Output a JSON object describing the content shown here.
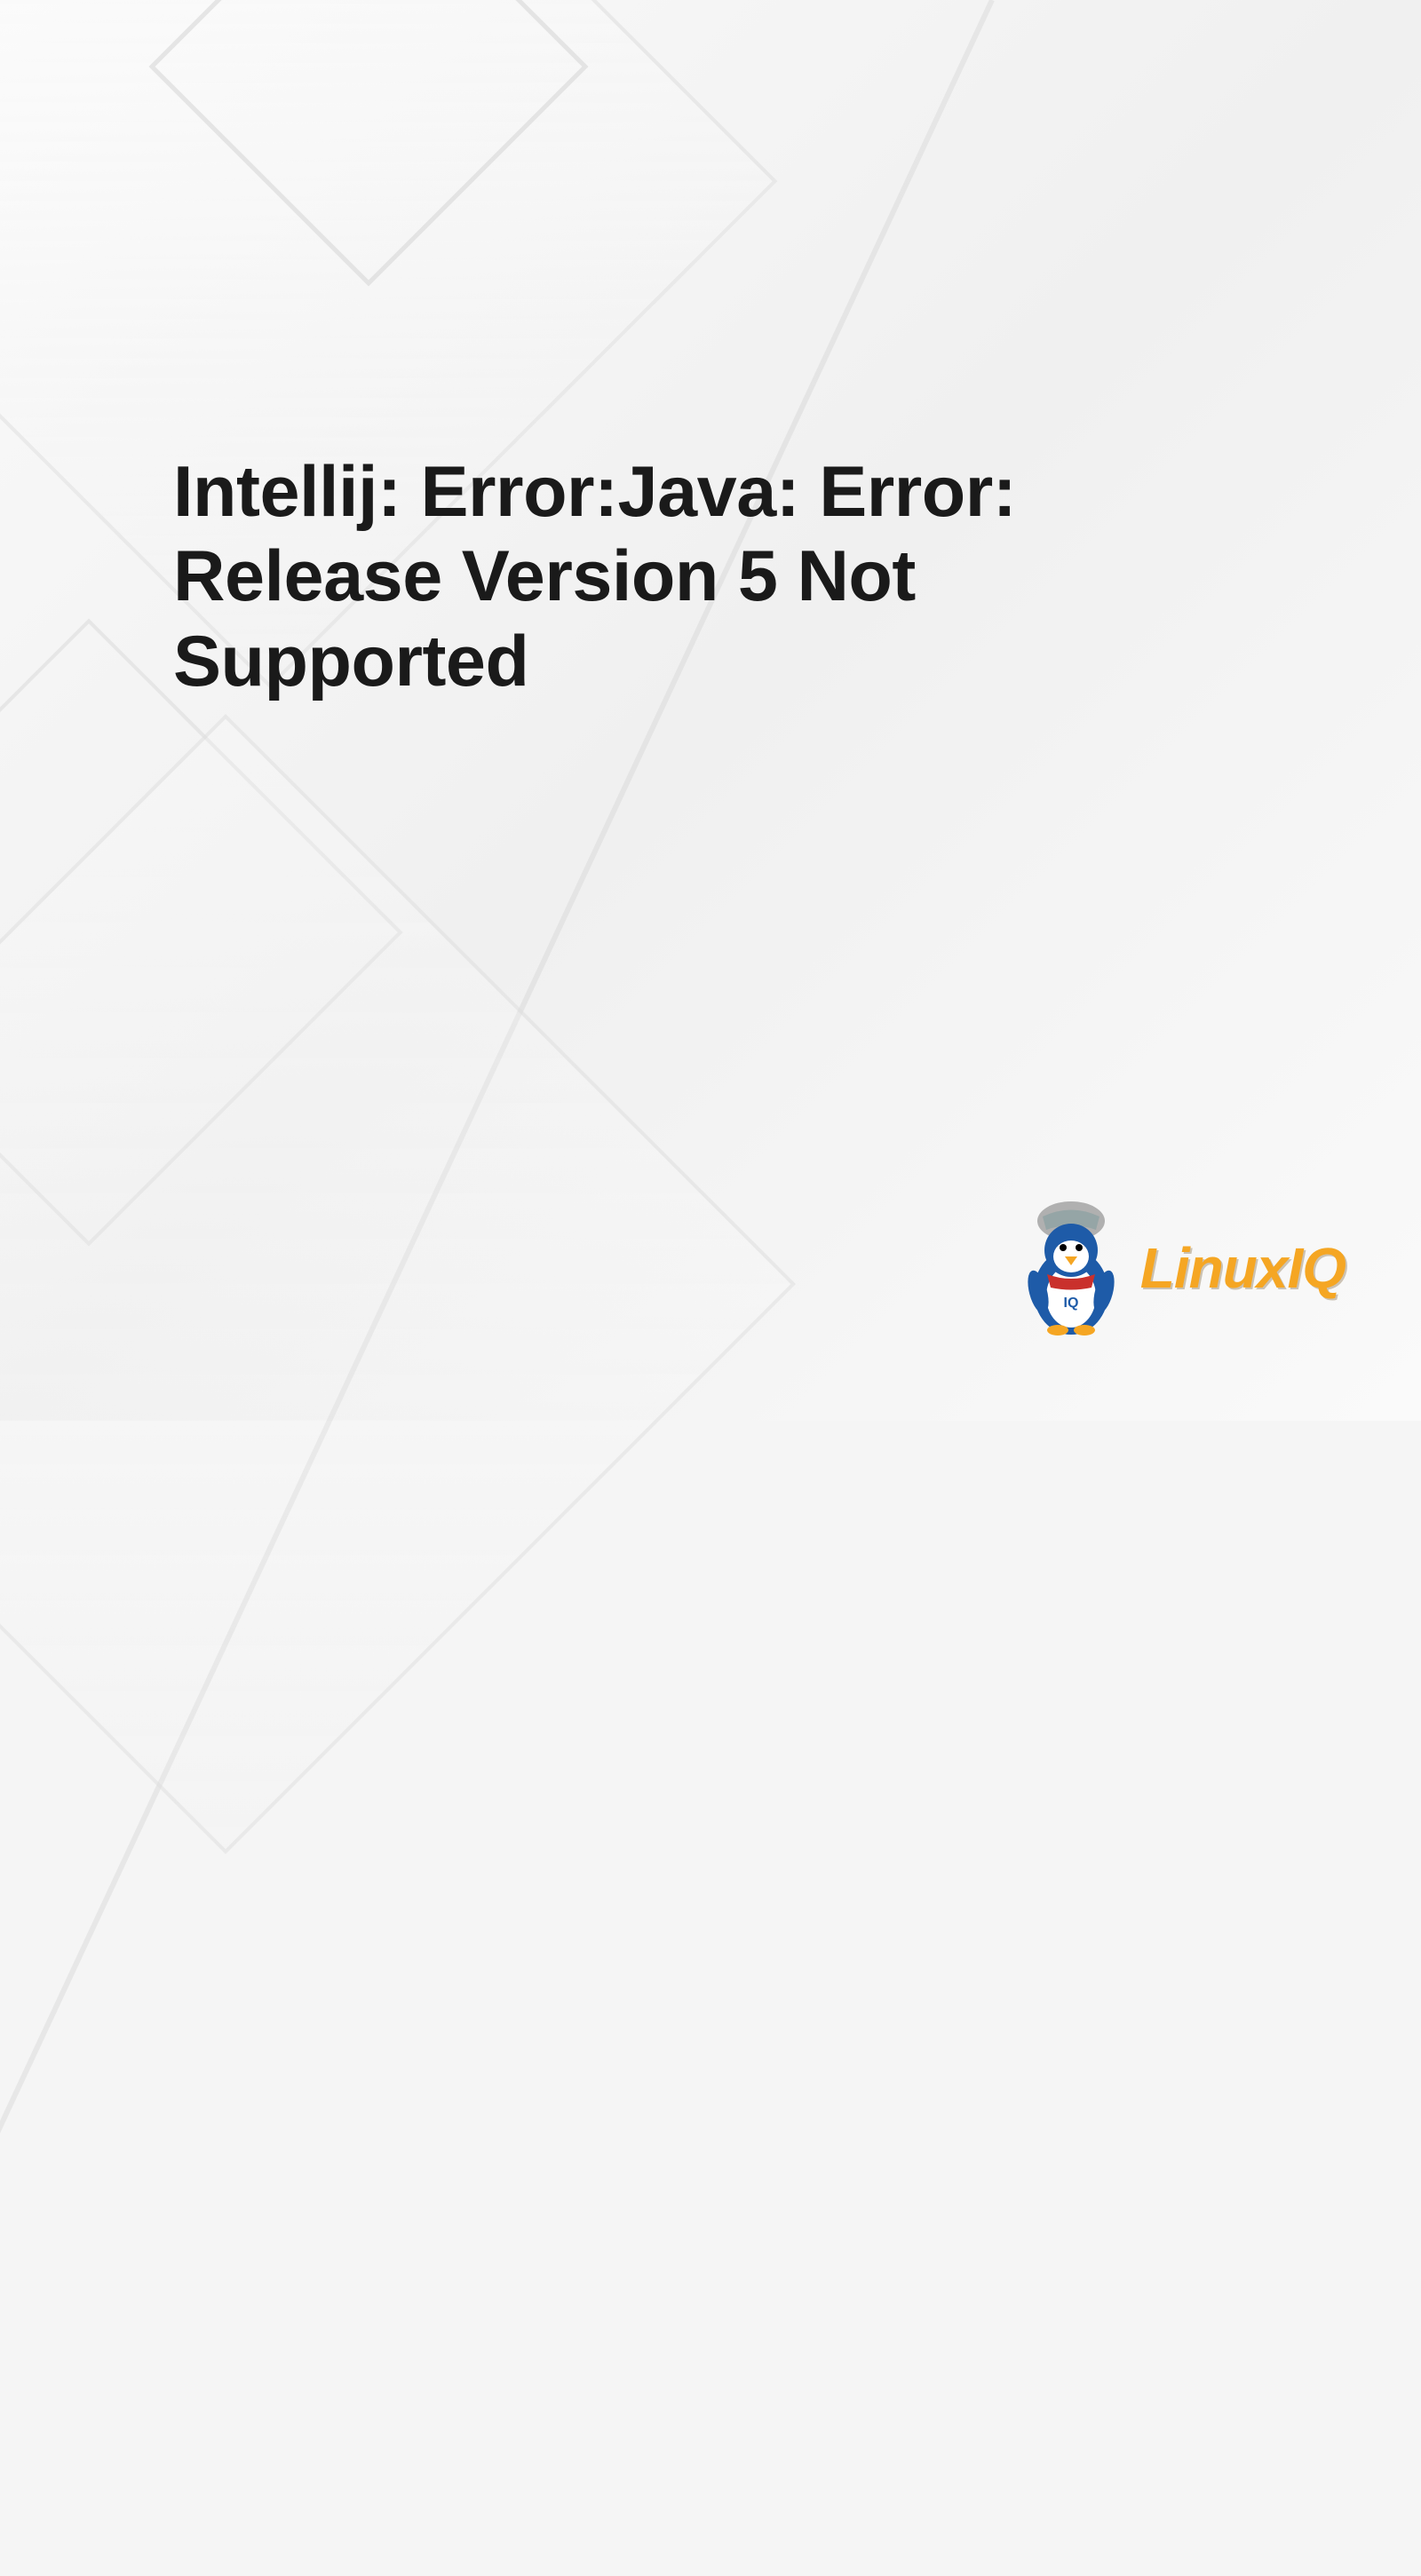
{
  "title": "Intellij: Error:Java: Error: Release Version 5 Not Supported",
  "logo": {
    "text": "LinuxIQ",
    "icon": "penguin-with-hat"
  },
  "colors": {
    "title_text": "#1a1a1a",
    "logo_text": "#f5a623",
    "background": "#f5f5f5",
    "pattern": "#dcdcdc"
  }
}
